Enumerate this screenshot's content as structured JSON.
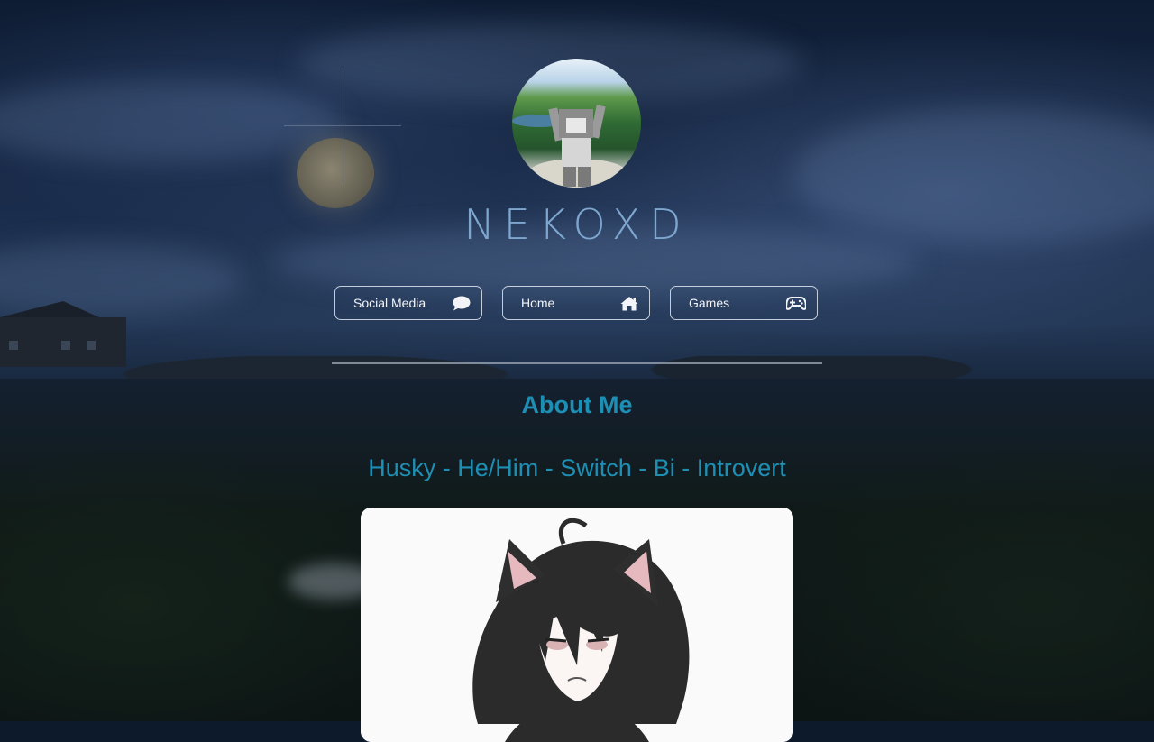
{
  "site": {
    "title": "NEKOXD"
  },
  "nav": {
    "items": [
      {
        "label": "Social Media",
        "icon": "chat-bubble-icon"
      },
      {
        "label": "Home",
        "icon": "home-icon"
      },
      {
        "label": "Games",
        "icon": "gamepad-icon"
      }
    ]
  },
  "about": {
    "heading": "About Me",
    "tagline": "Husky - He/Him - Switch - Bi - Introvert"
  },
  "colors": {
    "title": "#7ea7cf",
    "accent": "#1e8fb4",
    "button_border": "#e1e6f0",
    "button_text": "#f3f4f7"
  }
}
